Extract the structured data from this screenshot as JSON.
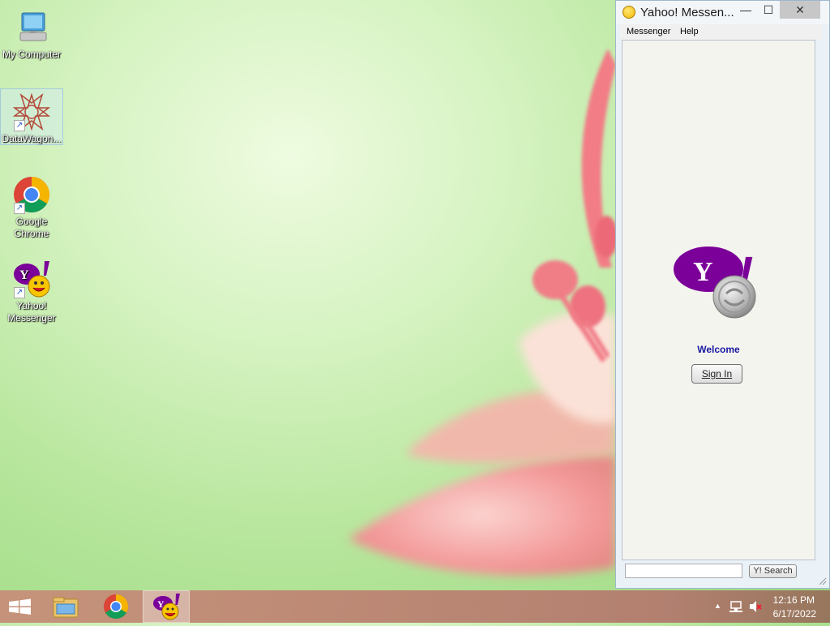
{
  "desktop": {
    "icons": [
      {
        "label": "My Computer"
      },
      {
        "label": "DataWagon..."
      },
      {
        "label": "Google Chrome"
      },
      {
        "label": "Yahoo! Messenger"
      }
    ]
  },
  "messenger": {
    "title": "Yahoo! Messen...",
    "menu": [
      "Messenger",
      "Help"
    ],
    "welcome": "Welcome",
    "sign_in": "Sign In",
    "search_placeholder": "",
    "search_button": "Y! Search",
    "logo_letter": "Y",
    "logo_bang": "!"
  },
  "taskbar": {
    "clock_time": "12:16 PM",
    "clock_date": "6/17/2022",
    "tray_chevron": "▲"
  },
  "colors": {
    "yahoo_purple": "#7b0099",
    "welcome_blue": "#1818a4"
  }
}
